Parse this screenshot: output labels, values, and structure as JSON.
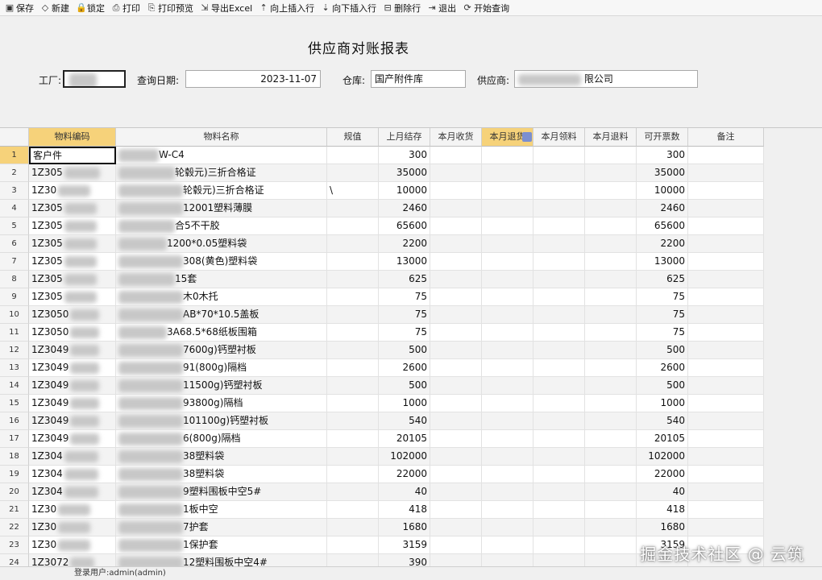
{
  "toolbar": [
    {
      "icon": "save-icon",
      "glyph": "▣",
      "label": "保存"
    },
    {
      "icon": "new-icon",
      "glyph": "◇",
      "label": "新建"
    },
    {
      "icon": "lock-icon",
      "glyph": "🔒",
      "label": "锁定"
    },
    {
      "icon": "print-icon",
      "glyph": "⎙",
      "label": "打印"
    },
    {
      "icon": "print-preview-icon",
      "glyph": "⎘",
      "label": "打印预览"
    },
    {
      "icon": "export-excel-icon",
      "glyph": "⇲",
      "label": "导出Excel"
    },
    {
      "icon": "insert-above-icon",
      "glyph": "⇡",
      "label": "向上插入行"
    },
    {
      "icon": "insert-below-icon",
      "glyph": "⇣",
      "label": "向下插入行"
    },
    {
      "icon": "delete-row-icon",
      "glyph": "⊟",
      "label": "删除行"
    },
    {
      "icon": "exit-icon",
      "glyph": "⇥",
      "label": "退出"
    },
    {
      "icon": "query-icon",
      "glyph": "⟳",
      "label": "开始查询"
    }
  ],
  "form": {
    "title": "供应商对账报表",
    "factory_label": "工厂:",
    "factory_value": "",
    "date_label": "查询日期:",
    "date_value": "2023-11-07",
    "warehouse_label": "仓库:",
    "warehouse_value": "国产附件库",
    "supplier_label": "供应商:",
    "supplier_value": "限公司"
  },
  "grid": {
    "columns": [
      "物料编码",
      "物料名称",
      "规值",
      "上月结存",
      "本月收货",
      "本月退货",
      "本月领料",
      "本月退料",
      "可开票数",
      "备注"
    ],
    "rows": [
      {
        "no": "1",
        "code": "客户件",
        "name": "W-C4",
        "spec": "",
        "last": "300",
        "inv": "300"
      },
      {
        "no": "2",
        "code": "1Z305",
        "name": "轮毂元)三折合格证",
        "spec": "",
        "last": "35000",
        "inv": "35000"
      },
      {
        "no": "3",
        "code": "1Z30",
        "name": "轮毂元)三折合格证",
        "spec": "\\",
        "last": "10000",
        "inv": "10000"
      },
      {
        "no": "4",
        "code": "1Z305",
        "name": "12001塑料薄膜",
        "spec": "",
        "last": "2460",
        "inv": "2460"
      },
      {
        "no": "5",
        "code": "1Z305",
        "name": "合5不干胶",
        "spec": "",
        "last": "65600",
        "inv": "65600"
      },
      {
        "no": "6",
        "code": "1Z305",
        "name": "1200*0.05塑料袋",
        "spec": "",
        "last": "2200",
        "inv": "2200"
      },
      {
        "no": "7",
        "code": "1Z305",
        "name": "308(黄色)塑料袋",
        "spec": "",
        "last": "13000",
        "inv": "13000"
      },
      {
        "no": "8",
        "code": "1Z305",
        "name": "15套",
        "spec": "",
        "last": "625",
        "inv": "625"
      },
      {
        "no": "9",
        "code": "1Z305",
        "name": "木0木托",
        "spec": "",
        "last": "75",
        "inv": "75"
      },
      {
        "no": "10",
        "code": "1Z3050",
        "name": "AB*70*10.5盖板",
        "spec": "",
        "last": "75",
        "inv": "75"
      },
      {
        "no": "11",
        "code": "1Z3050",
        "name": "3A68.5*68纸板围箱",
        "spec": "",
        "last": "75",
        "inv": "75"
      },
      {
        "no": "12",
        "code": "1Z3049",
        "name": "7600g)钙塑衬板",
        "spec": "",
        "last": "500",
        "inv": "500"
      },
      {
        "no": "13",
        "code": "1Z3049",
        "name": "91(800g)隔档",
        "spec": "",
        "last": "2600",
        "inv": "2600"
      },
      {
        "no": "14",
        "code": "1Z3049",
        "name": "11500g)钙塑衬板",
        "spec": "",
        "last": "500",
        "inv": "500"
      },
      {
        "no": "15",
        "code": "1Z3049",
        "name": "93800g)隔档",
        "spec": "",
        "last": "1000",
        "inv": "1000"
      },
      {
        "no": "16",
        "code": "1Z3049",
        "name": "101100g)钙塑衬板",
        "spec": "",
        "last": "540",
        "inv": "540"
      },
      {
        "no": "17",
        "code": "1Z3049",
        "name": "6(800g)隔档",
        "spec": "",
        "last": "20105",
        "inv": "20105"
      },
      {
        "no": "18",
        "code": "1Z304",
        "name": "38塑料袋",
        "spec": "",
        "last": "102000",
        "inv": "102000"
      },
      {
        "no": "19",
        "code": "1Z304",
        "name": "38塑料袋",
        "spec": "",
        "last": "22000",
        "inv": "22000"
      },
      {
        "no": "20",
        "code": "1Z304",
        "name": "9塑料围板中空5#",
        "spec": "",
        "last": "40",
        "inv": "40"
      },
      {
        "no": "21",
        "code": "1Z30",
        "name": "1板中空",
        "spec": "",
        "last": "418",
        "inv": "418"
      },
      {
        "no": "22",
        "code": "1Z30",
        "name": "7护套",
        "spec": "",
        "last": "1680",
        "inv": "1680"
      },
      {
        "no": "23",
        "code": "1Z30",
        "name": "1保护套",
        "spec": "",
        "last": "3159",
        "inv": "3159"
      },
      {
        "no": "24",
        "code": "1Z3072",
        "name": "12塑料围板中空4#",
        "spec": "",
        "last": "390",
        "inv": ""
      }
    ]
  },
  "status": {
    "text": "登录用户:admin(admin)"
  },
  "watermark": "掘金技术社区 @ 云筑"
}
